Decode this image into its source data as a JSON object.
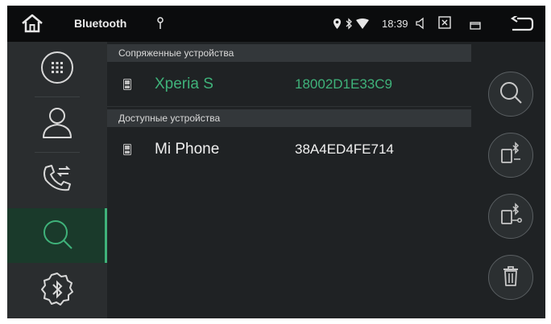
{
  "statusbar": {
    "title": "Bluetooth",
    "time": "18:39",
    "icons": [
      "home-icon",
      "usb-icon",
      "location-pin-icon",
      "bluetooth-icon",
      "wifi-icon",
      "volume-icon",
      "screenshot-icon",
      "window-icon",
      "back-icon"
    ]
  },
  "sidebar": {
    "items": [
      {
        "name": "dialpad",
        "icon": "dialpad-icon",
        "active": false
      },
      {
        "name": "contacts",
        "icon": "person-icon",
        "active": false
      },
      {
        "name": "call-log",
        "icon": "call-transfer-icon",
        "active": false
      },
      {
        "name": "search",
        "icon": "search-icon",
        "active": true
      },
      {
        "name": "bluetooth-settings",
        "icon": "bluetooth-gear-icon",
        "active": false
      }
    ],
    "accent": "#3fb27a"
  },
  "paired": {
    "header": "Сопряженные устройства",
    "devices": [
      {
        "name": "Xperia S",
        "mac": "18002D1E33C9",
        "color": "#3fb27a"
      }
    ]
  },
  "available": {
    "header": "Доступные устройства",
    "devices": [
      {
        "name": "Mi Phone",
        "mac": "38A4ED4FE714",
        "color": "#ffffff"
      }
    ]
  },
  "actions": [
    {
      "name": "search",
      "icon": "search-icon"
    },
    {
      "name": "phone-bluetooth-connect",
      "icon": "phone-bluetooth-icon"
    },
    {
      "name": "phone-bluetooth-disconnect",
      "icon": "phone-bluetooth-link-icon"
    },
    {
      "name": "delete",
      "icon": "trash-icon"
    }
  ]
}
